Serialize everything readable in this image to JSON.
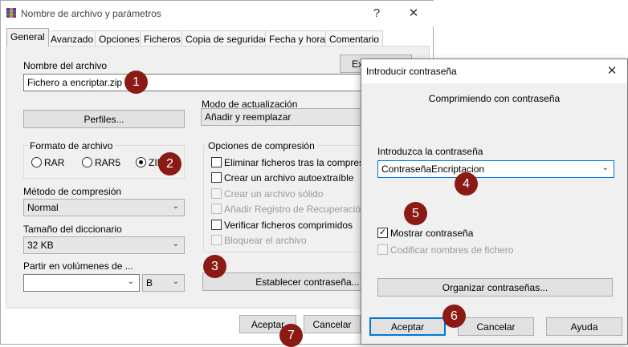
{
  "main": {
    "title": "Nombre de archivo y parámetros",
    "help": "?",
    "close": "✕",
    "tabs": [
      "General",
      "Avanzado",
      "Opciones",
      "Ficheros",
      "Copia de seguridad",
      "Fecha y hora",
      "Comentario"
    ],
    "archive_name_label": "Nombre del archivo",
    "archive_name_value": "Fichero a encriptar.zip",
    "browse_button": "Examinar...",
    "profiles_button": "Perfiles...",
    "update_mode_label": "Modo de actualización",
    "update_mode_value": "Añadir y reemplazar",
    "format_group_title": "Formato de archivo",
    "format_options": [
      "RAR",
      "RAR5",
      "ZIP"
    ],
    "format_selected": "ZIP",
    "compression_options_title": "Opciones de compresión",
    "compression_options": [
      {
        "label": "Eliminar ficheros tras la compresión",
        "checked": false,
        "enabled": true
      },
      {
        "label": "Crear un archivo autoextraíble",
        "checked": false,
        "enabled": true
      },
      {
        "label": "Crear un archivo sólido",
        "checked": false,
        "enabled": false
      },
      {
        "label": "Añadir Registro de Recuperación",
        "checked": false,
        "enabled": false
      },
      {
        "label": "Verificar ficheros comprimidos",
        "checked": false,
        "enabled": true
      },
      {
        "label": "Bloquear el archivo",
        "checked": false,
        "enabled": false
      }
    ],
    "method_label": "Método de compresión",
    "method_value": "Normal",
    "dict_label": "Tamaño del diccionario",
    "dict_value": "32 KB",
    "split_label": "Partir en volúmenes de ...",
    "split_value": "",
    "split_unit": "B",
    "set_password_button": "Establecer contraseña...",
    "ok_button": "Aceptar",
    "cancel_button": "Cancelar"
  },
  "password_dialog": {
    "title": "Introducir contraseña",
    "close": "✕",
    "subtitle": "Comprimiendo con contraseña",
    "enter_label": "Introduzca la contraseña",
    "password_value": "ContraseñaEncriptacion",
    "show_password_label": "Mostrar contraseña",
    "show_password_checked": true,
    "encrypt_names_label": "Codificar nombres de fichero",
    "encrypt_names_enabled": false,
    "organize_button": "Organizar contraseñas...",
    "ok_button": "Aceptar",
    "cancel_button": "Cancelar",
    "help_button": "Ayuda"
  },
  "annotations": [
    "1",
    "2",
    "3",
    "4",
    "5",
    "6",
    "7"
  ],
  "colors": {
    "badge": "#8b1a14",
    "focus": "#0078d7",
    "panel": "#f0f0f0"
  },
  "icons": {
    "app": "winrar-icon",
    "dropdown": "chevron-down-icon",
    "close": "close-icon"
  }
}
